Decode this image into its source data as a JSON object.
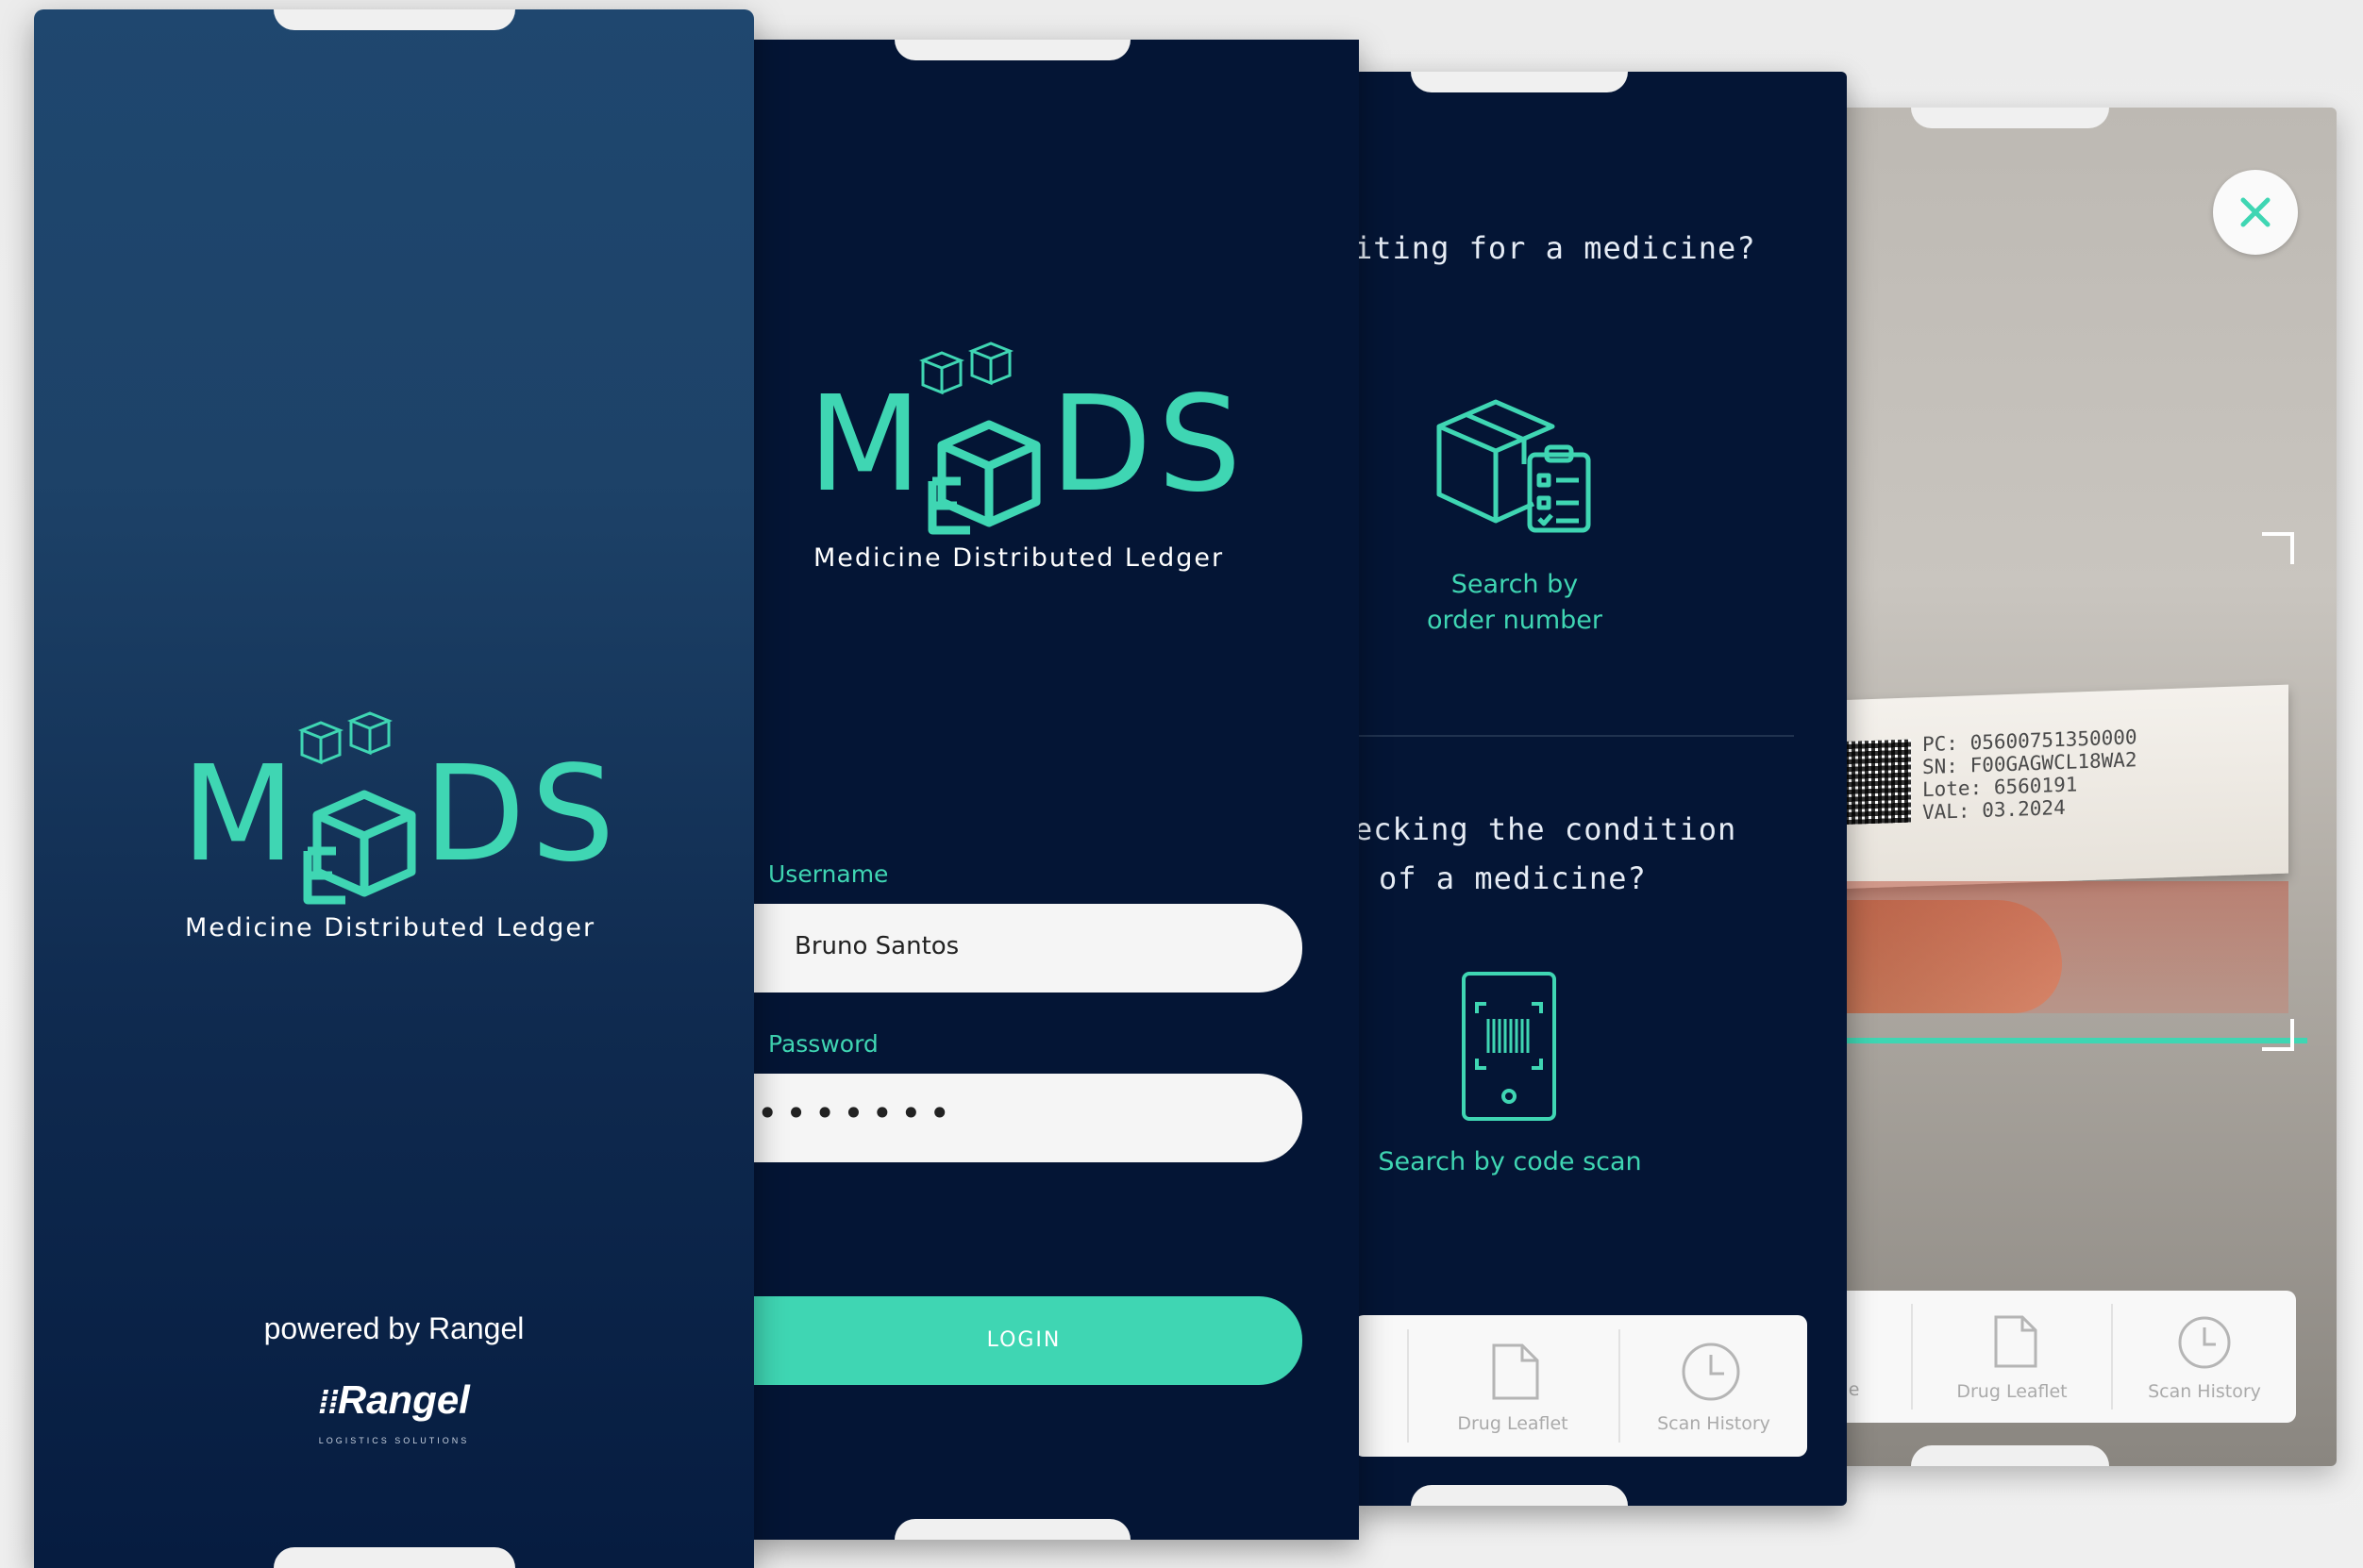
{
  "brand": {
    "logo_letters": "MEDS",
    "logo_m": "M",
    "logo_e": "E",
    "logo_ds": "DS",
    "tagline": "Medicine Distributed Ledger",
    "accent_color": "#3fd6b3",
    "background_color": "#041535"
  },
  "splash": {
    "powered_by": "powered by Rangel",
    "company_logo": "Rangel",
    "company_tagline": "LOGISTICS SOLUTIONS"
  },
  "login": {
    "username_label": "Username",
    "username_value": "Bruno Santos",
    "password_label": "Password",
    "password_value": "•••••••",
    "login_button": "LOGIN"
  },
  "home": {
    "question_waiting": "iting for a medicine?",
    "search_order_label_line1": "Search by",
    "search_order_label_line2": "order number",
    "question_condition_line1": "ecking the condition",
    "question_condition_line2": "of a medicine?",
    "search_scan_label": "Search by code scan",
    "tabs": [
      "Drug Leaflet",
      "Scan History"
    ],
    "tab_icons": [
      "document-icon",
      "clock-icon"
    ]
  },
  "scanner": {
    "label_lines": [
      "PC: 05600751350000",
      "SN: F00GAGWCL18WA2",
      "Lote: 6560191",
      "VAL: 03.2024"
    ],
    "tabs": [
      "age",
      "Drug Leaflet",
      "Scan History"
    ],
    "tab_icons": [
      "image-icon",
      "document-icon",
      "clock-icon"
    ],
    "close_icon": "close-icon"
  }
}
